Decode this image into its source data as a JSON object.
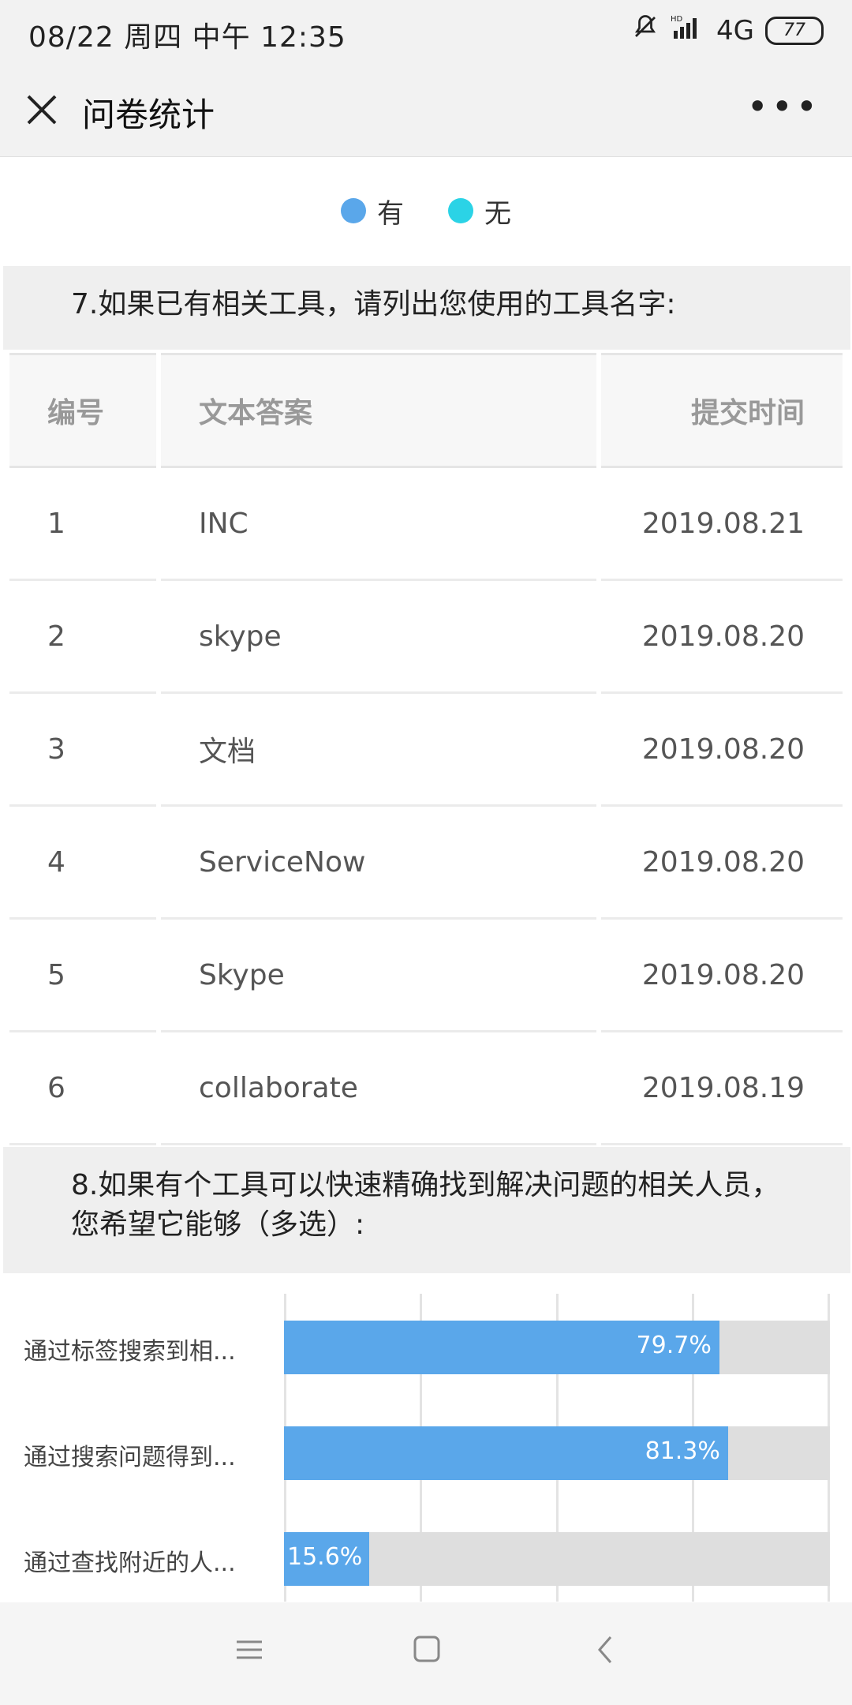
{
  "status": {
    "time": "08/22 周四 中午 12:35",
    "network": "4G",
    "battery": "77"
  },
  "nav": {
    "title": "问卷统计"
  },
  "legend": [
    {
      "label": "有",
      "color": "#5aa7ea"
    },
    {
      "label": "无",
      "color": "#2bd3e6"
    }
  ],
  "q7": {
    "title": "7.如果已有相关工具，请列出您使用的工具名字:"
  },
  "table": {
    "headers": [
      "编号",
      "文本答案",
      "提交时间"
    ],
    "rows": [
      [
        "1",
        "INC",
        "2019.08.21"
      ],
      [
        "2",
        "skype",
        "2019.08.20"
      ],
      [
        "3",
        "文档",
        "2019.08.20"
      ],
      [
        "4",
        "ServiceNow",
        "2019.08.20"
      ],
      [
        "5",
        "Skype",
        "2019.08.20"
      ],
      [
        "6",
        "collaborate",
        "2019.08.19"
      ]
    ]
  },
  "q8": {
    "title": "8.如果有个工具可以快速精确找到解决问题的相关人员，您希望它能够（多选）:"
  },
  "chart_data": {
    "type": "bar",
    "orientation": "horizontal",
    "categories": [
      "通过标签搜索到相...",
      "通过搜索问题得到...",
      "通过查找附近的人..."
    ],
    "values": [
      79.7,
      81.3,
      15.6
    ],
    "value_labels": [
      "79.7%",
      "81.3%",
      "15.6%"
    ],
    "xlim": [
      0,
      100
    ],
    "grid": true,
    "bar_color": "#5aa7ea"
  }
}
